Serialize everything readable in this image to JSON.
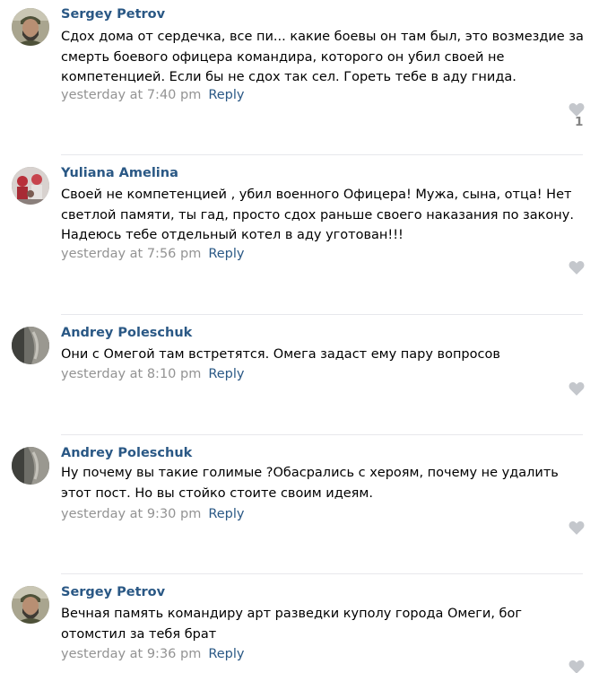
{
  "comments": [
    {
      "author": "Sergey Petrov",
      "avatar": "user-photo-sergey",
      "text": "Сдох дома от сердечка, все пи... какие боевы он там был, это возмездие за смерть боевого офицера командира, которого он убил своей не компетенцией. Если бы не сдох так сел. Гореть тебе в аду гнида.",
      "time": "yesterday at 7:40 pm",
      "reply": "Reply",
      "likes": "1"
    },
    {
      "author": "Yuliana Amelina",
      "avatar": "user-photo-yuliana",
      "text": "Своей не компетенцией , убил военного Офицера! Мужа, сына, отца! Нет светлой памяти, ты гад, просто сдох раньше своего наказания по закону. Надеюсь тебе отдельный котел в аду уготован!!!",
      "time": "yesterday at 7:56 pm",
      "reply": "Reply"
    },
    {
      "author": "Andrey Poleschuk",
      "avatar": "user-photo-andrey",
      "text": "Они с Омегой там встретятся. Омега задаст ему пару вопросов",
      "time": "yesterday at 8:10 pm",
      "reply": "Reply"
    },
    {
      "author": "Andrey Poleschuk",
      "avatar": "user-photo-andrey",
      "text": "Ну почему вы такие голимые ?Обасрались с хероям, почему не удалить этот пост. Но вы стойко стоите своим идеям.",
      "time": "yesterday at 9:30 pm",
      "reply": "Reply"
    },
    {
      "author": "Sergey Petrov",
      "avatar": "user-photo-sergey",
      "text": "Вечная память командиру арт разведки куполу города Омеги, бог отомстил за тебя брат",
      "time": "yesterday at 9:36 pm",
      "reply": "Reply"
    }
  ],
  "icons": {
    "like": "heart-icon"
  },
  "colors": {
    "link": "#2a5885",
    "meta": "#939393",
    "like_icon": "#c4c7cc",
    "like_count": "#828282",
    "divider": "#e7e8ec"
  }
}
